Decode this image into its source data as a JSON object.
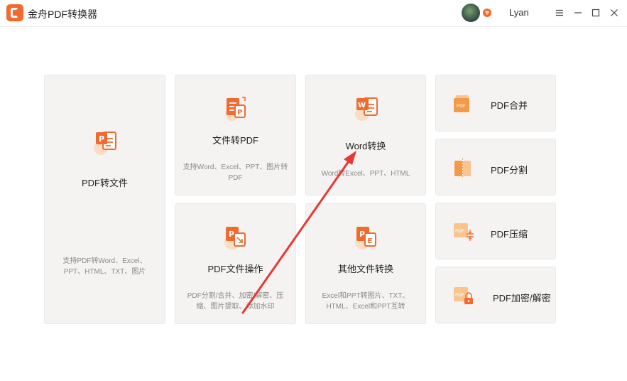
{
  "app": {
    "title": "金舟PDF转换器"
  },
  "user": {
    "name": "Lyan"
  },
  "colors": {
    "accent": "#f26a2e",
    "icon_light": "#f9c58f",
    "card_bg": "#f5f3f1",
    "arrow": "#e53935"
  },
  "cards": {
    "pdf_to_file": {
      "title": "PDF转文件",
      "desc": "支持PDF转Word、Excel、PPT、HTML、TXT、图片"
    },
    "file_to_pdf": {
      "title": "文件转PDF",
      "desc": "支持Word、Excel、PPT、图片转PDF"
    },
    "word_convert": {
      "title": "Word转换",
      "desc": "Word转Excel、PPT、HTML"
    },
    "pdf_ops": {
      "title": "PDF文件操作",
      "desc": "PDF分割/合并、加密/解密、压缩、图片提取、添加水印"
    },
    "other_convert": {
      "title": "其他文件转换",
      "desc": "Excel和PPT转图片、TXT、HTML、Excel和PPT互转"
    }
  },
  "side": {
    "merge": {
      "title": "PDF合并"
    },
    "split": {
      "title": "PDF分割"
    },
    "compress": {
      "title": "PDF压缩"
    },
    "encrypt": {
      "title": "PDF加密/解密"
    }
  },
  "icons": {
    "logo": "app-logo-icon",
    "vip": "vip-diamond-icon",
    "menu": "menu-icon",
    "minimize": "minimize-icon",
    "maximize": "maximize-icon",
    "close": "close-icon"
  }
}
